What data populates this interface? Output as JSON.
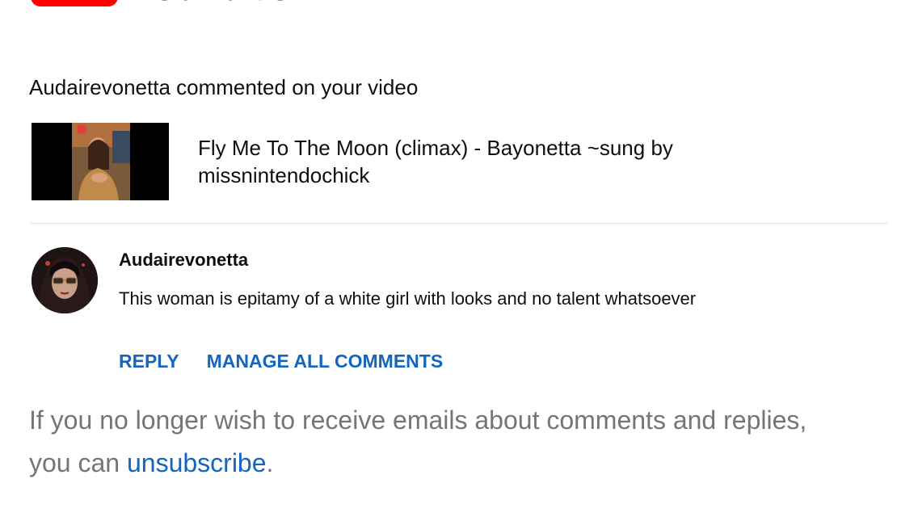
{
  "notification": {
    "headline": "Audairevonetta commented on your video"
  },
  "video": {
    "title": "Fly Me To The Moon (climax) - Bayonetta ~sung by missnintendochick"
  },
  "comment": {
    "author": "Audairevonetta",
    "text": "This woman is epitamy of a white girl with looks and no talent whatsoever"
  },
  "actions": {
    "reply": "REPLY",
    "manage": "MANAGE ALL COMMENTS"
  },
  "footer": {
    "text_before": "If you no longer wish to receive emails about comments and replies, you can ",
    "unsubscribe_link": "unsubscribe",
    "text_after": "."
  },
  "colors": {
    "brand_red": "#ff0000",
    "link_blue": "#1565c0",
    "muted_gray": "#757575",
    "divider": "#e0e0e0"
  }
}
